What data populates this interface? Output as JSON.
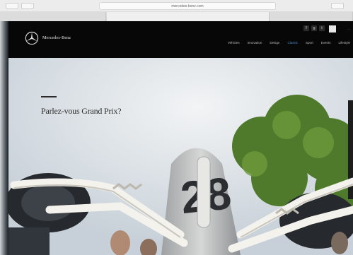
{
  "browser": {
    "url": "mercedes-benz.com",
    "tabs": [
      {
        "label": ""
      },
      {
        "label": ""
      },
      {
        "label": ""
      }
    ]
  },
  "header": {
    "brand": "Mercedes-Benz",
    "util_links": [
      "",
      "",
      "",
      ""
    ],
    "social_icons": [
      "facebook-icon",
      "google-plus-icon",
      "twitter-icon"
    ],
    "main_nav": [
      {
        "label": "Vehicles"
      },
      {
        "label": "Innovation"
      },
      {
        "label": "Design"
      },
      {
        "label": "Classic",
        "active": true
      },
      {
        "label": "Sport"
      },
      {
        "label": "Events"
      },
      {
        "label": "Lifestyle"
      }
    ],
    "active_color": "#4d8fd1"
  },
  "hero": {
    "title": "Parlez-vous Grand Prix?",
    "subtitle": "",
    "race_number": "28"
  }
}
